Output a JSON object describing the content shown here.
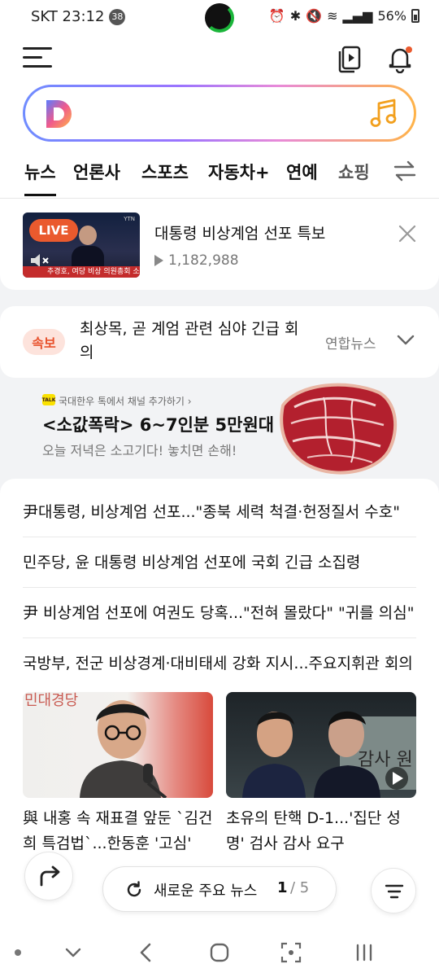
{
  "status_bar": {
    "carrier_time": "SKT 23:12",
    "badge": "38",
    "battery": "56%"
  },
  "icons": {
    "menu": "menu-icon",
    "copy": "copy-play-icon",
    "bell": "bell-icon",
    "logo": "daum-d-logo",
    "music": "music-note-icon",
    "swap": "swap-arrows-icon"
  },
  "search": {
    "placeholder": ""
  },
  "tabs": [
    {
      "label": "뉴스"
    },
    {
      "label": "언론사"
    },
    {
      "label": "스포츠"
    },
    {
      "label": "자동차+"
    },
    {
      "label": "연예"
    },
    {
      "label": "쇼핑"
    }
  ],
  "live": {
    "badge": "LIVE",
    "thumb_caption": "추경호, 여당 비상 의원총회 소집",
    "thumb_channel": "YTN",
    "title": "대통령 비상계엄 선포 특보",
    "views": "1,182,988"
  },
  "breaking": {
    "badge": "속보",
    "headline": "최상목, 곧 계엄 관련 심야 긴급 회의",
    "source": "연합뉴스"
  },
  "ad": {
    "talk_label": "TALK",
    "channel": "국대한우 톡에서 채널 추가하기 ›",
    "headline": "<소값폭락> 6~7인분 5만원대",
    "subline": "오늘 저녁은 소고기다! 놓치면 손해!"
  },
  "headlines": [
    "尹대통령, 비상계엄 선포...\"종북 세력 척결·헌정질서 수호\"",
    "민주당, 윤 대통령 비상계엄 선포에 국회 긴급 소집령",
    "尹 비상계엄 선포에 여권도 당혹...\"전혀 몰랐다\" \"귀를 의심\"",
    "국방부, 전군 비상경계·대비태세 강화 지시...주요지휘관 회의"
  ],
  "photo_news": [
    {
      "caption": "與 내홍 속 재표결 앞둔 `김건희 특검법`...한동훈 '고심'"
    },
    {
      "caption": "초유의 탄핵 D-1...'집단 성명' 검사 감사 요구"
    }
  ],
  "more_news": {
    "label": "새로운 주요 뉴스",
    "current": "1",
    "total": "/ 5"
  },
  "colors": {
    "accent_orange": "#ea5a2e",
    "breaking_bg": "#fde3dc",
    "kakao_yellow": "#fae100"
  }
}
